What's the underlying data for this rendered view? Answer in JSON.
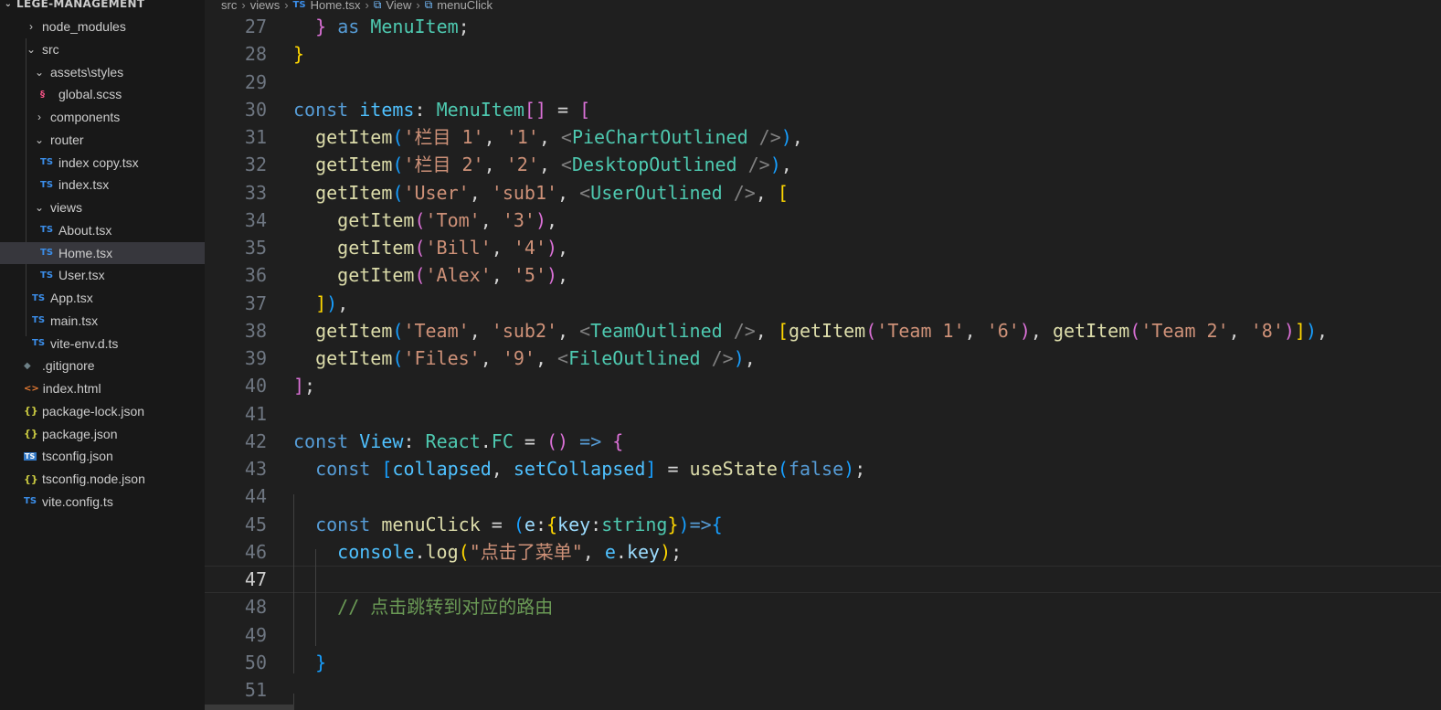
{
  "explorer": {
    "project_name": "LEGE-MANAGEMENT",
    "items": [
      {
        "label": "node_modules",
        "type": "folder",
        "expanded": false,
        "depth": 0,
        "icon": "chevron-right"
      },
      {
        "label": "src",
        "type": "folder",
        "expanded": true,
        "depth": 0,
        "icon": "chevron-down"
      },
      {
        "label": "assets\\styles",
        "type": "folder",
        "expanded": true,
        "depth": 1,
        "icon": "chevron-down"
      },
      {
        "label": "global.scss",
        "type": "file",
        "depth": 2,
        "icon": "scss-icon"
      },
      {
        "label": "components",
        "type": "folder",
        "expanded": false,
        "depth": 1,
        "icon": "chevron-right"
      },
      {
        "label": "router",
        "type": "folder",
        "expanded": true,
        "depth": 1,
        "icon": "chevron-down"
      },
      {
        "label": "index copy.tsx",
        "type": "file",
        "depth": 2,
        "icon": "ts-icon"
      },
      {
        "label": "index.tsx",
        "type": "file",
        "depth": 2,
        "icon": "ts-icon"
      },
      {
        "label": "views",
        "type": "folder",
        "expanded": true,
        "depth": 1,
        "icon": "chevron-down"
      },
      {
        "label": "About.tsx",
        "type": "file",
        "depth": 2,
        "icon": "ts-icon"
      },
      {
        "label": "Home.tsx",
        "type": "file",
        "depth": 2,
        "icon": "ts-icon",
        "selected": true
      },
      {
        "label": "User.tsx",
        "type": "file",
        "depth": 2,
        "icon": "ts-icon"
      },
      {
        "label": "App.tsx",
        "type": "file",
        "depth": 1,
        "icon": "ts-icon"
      },
      {
        "label": "main.tsx",
        "type": "file",
        "depth": 1,
        "icon": "ts-icon"
      },
      {
        "label": "vite-env.d.ts",
        "type": "file",
        "depth": 1,
        "icon": "ts-icon"
      },
      {
        "label": ".gitignore",
        "type": "file",
        "depth": 0,
        "icon": "git-icon"
      },
      {
        "label": "index.html",
        "type": "file",
        "depth": 0,
        "icon": "html-icon"
      },
      {
        "label": "package-lock.json",
        "type": "file",
        "depth": 0,
        "icon": "json-icon"
      },
      {
        "label": "package.json",
        "type": "file",
        "depth": 0,
        "icon": "json-icon"
      },
      {
        "label": "tsconfig.json",
        "type": "file",
        "depth": 0,
        "icon": "tsconfig-icon"
      },
      {
        "label": "tsconfig.node.json",
        "type": "file",
        "depth": 0,
        "icon": "json-icon"
      },
      {
        "label": "vite.config.ts",
        "type": "file",
        "depth": 0,
        "icon": "ts-icon"
      }
    ]
  },
  "breadcrumb": {
    "items": [
      "src",
      "views",
      "Home.tsx",
      "View",
      "menuClick"
    ],
    "ts_badge": "TS"
  },
  "editor": {
    "current_line": 47,
    "lines": [
      {
        "n": "27",
        "tokens": [
          [
            "  ",
            "punc"
          ],
          [
            "}",
            "b2"
          ],
          [
            " ",
            "punc"
          ],
          [
            "as",
            "kw"
          ],
          [
            " ",
            "punc"
          ],
          [
            "MenuItem",
            "type"
          ],
          [
            ";",
            "punc"
          ]
        ]
      },
      {
        "n": "28",
        "tokens": [
          [
            "}",
            "b1"
          ]
        ]
      },
      {
        "n": "29",
        "tokens": []
      },
      {
        "n": "30",
        "tokens": [
          [
            "const",
            "kw"
          ],
          [
            " ",
            "punc"
          ],
          [
            "items",
            "var"
          ],
          [
            ": ",
            "punc"
          ],
          [
            "MenuItem",
            "type"
          ],
          [
            "[]",
            "b2"
          ],
          [
            " = ",
            "punc"
          ],
          [
            "[",
            "b2"
          ]
        ]
      },
      {
        "n": "31",
        "tokens": [
          [
            "  ",
            "punc"
          ],
          [
            "getItem",
            "fn"
          ],
          [
            "(",
            "b3"
          ],
          [
            "'栏目 1'",
            "str"
          ],
          [
            ", ",
            "punc"
          ],
          [
            "'1'",
            "str"
          ],
          [
            ", ",
            "punc"
          ],
          [
            "<",
            "tag"
          ],
          [
            "PieChartOutlined",
            "type"
          ],
          [
            " />",
            "tag"
          ],
          [
            ")",
            "b3"
          ],
          [
            ",",
            "punc"
          ]
        ]
      },
      {
        "n": "32",
        "tokens": [
          [
            "  ",
            "punc"
          ],
          [
            "getItem",
            "fn"
          ],
          [
            "(",
            "b3"
          ],
          [
            "'栏目 2'",
            "str"
          ],
          [
            ", ",
            "punc"
          ],
          [
            "'2'",
            "str"
          ],
          [
            ", ",
            "punc"
          ],
          [
            "<",
            "tag"
          ],
          [
            "DesktopOutlined",
            "type"
          ],
          [
            " />",
            "tag"
          ],
          [
            ")",
            "b3"
          ],
          [
            ",",
            "punc"
          ]
        ]
      },
      {
        "n": "33",
        "tokens": [
          [
            "  ",
            "punc"
          ],
          [
            "getItem",
            "fn"
          ],
          [
            "(",
            "b3"
          ],
          [
            "'User'",
            "str"
          ],
          [
            ", ",
            "punc"
          ],
          [
            "'sub1'",
            "str"
          ],
          [
            ", ",
            "punc"
          ],
          [
            "<",
            "tag"
          ],
          [
            "UserOutlined",
            "type"
          ],
          [
            " />",
            "tag"
          ],
          [
            ", ",
            "punc"
          ],
          [
            "[",
            "b1"
          ]
        ]
      },
      {
        "n": "34",
        "tokens": [
          [
            "    ",
            "punc"
          ],
          [
            "getItem",
            "fn"
          ],
          [
            "(",
            "b2"
          ],
          [
            "'Tom'",
            "str"
          ],
          [
            ", ",
            "punc"
          ],
          [
            "'3'",
            "str"
          ],
          [
            ")",
            "b2"
          ],
          [
            ",",
            "punc"
          ]
        ]
      },
      {
        "n": "35",
        "tokens": [
          [
            "    ",
            "punc"
          ],
          [
            "getItem",
            "fn"
          ],
          [
            "(",
            "b2"
          ],
          [
            "'Bill'",
            "str"
          ],
          [
            ", ",
            "punc"
          ],
          [
            "'4'",
            "str"
          ],
          [
            ")",
            "b2"
          ],
          [
            ",",
            "punc"
          ]
        ]
      },
      {
        "n": "36",
        "tokens": [
          [
            "    ",
            "punc"
          ],
          [
            "getItem",
            "fn"
          ],
          [
            "(",
            "b2"
          ],
          [
            "'Alex'",
            "str"
          ],
          [
            ", ",
            "punc"
          ],
          [
            "'5'",
            "str"
          ],
          [
            ")",
            "b2"
          ],
          [
            ",",
            "punc"
          ]
        ]
      },
      {
        "n": "37",
        "tokens": [
          [
            "  ",
            "punc"
          ],
          [
            "]",
            "b1"
          ],
          [
            ")",
            "b3"
          ],
          [
            ",",
            "punc"
          ]
        ]
      },
      {
        "n": "38",
        "tokens": [
          [
            "  ",
            "punc"
          ],
          [
            "getItem",
            "fn"
          ],
          [
            "(",
            "b3"
          ],
          [
            "'Team'",
            "str"
          ],
          [
            ", ",
            "punc"
          ],
          [
            "'sub2'",
            "str"
          ],
          [
            ", ",
            "punc"
          ],
          [
            "<",
            "tag"
          ],
          [
            "TeamOutlined",
            "type"
          ],
          [
            " />",
            "tag"
          ],
          [
            ", ",
            "punc"
          ],
          [
            "[",
            "b1"
          ],
          [
            "getItem",
            "fn"
          ],
          [
            "(",
            "b2"
          ],
          [
            "'Team 1'",
            "str"
          ],
          [
            ", ",
            "punc"
          ],
          [
            "'6'",
            "str"
          ],
          [
            ")",
            "b2"
          ],
          [
            ", ",
            "punc"
          ],
          [
            "getItem",
            "fn"
          ],
          [
            "(",
            "b2"
          ],
          [
            "'Team 2'",
            "str"
          ],
          [
            ", ",
            "punc"
          ],
          [
            "'8'",
            "str"
          ],
          [
            ")",
            "b2"
          ],
          [
            "]",
            "b1"
          ],
          [
            ")",
            "b3"
          ],
          [
            ",",
            "punc"
          ]
        ]
      },
      {
        "n": "39",
        "tokens": [
          [
            "  ",
            "punc"
          ],
          [
            "getItem",
            "fn"
          ],
          [
            "(",
            "b3"
          ],
          [
            "'Files'",
            "str"
          ],
          [
            ", ",
            "punc"
          ],
          [
            "'9'",
            "str"
          ],
          [
            ", ",
            "punc"
          ],
          [
            "<",
            "tag"
          ],
          [
            "FileOutlined",
            "type"
          ],
          [
            " />",
            "tag"
          ],
          [
            ")",
            "b3"
          ],
          [
            ",",
            "punc"
          ]
        ]
      },
      {
        "n": "40",
        "tokens": [
          [
            "]",
            "b2"
          ],
          [
            ";",
            "punc"
          ]
        ]
      },
      {
        "n": "41",
        "tokens": []
      },
      {
        "n": "42",
        "tokens": [
          [
            "const",
            "kw"
          ],
          [
            " ",
            "punc"
          ],
          [
            "View",
            "var"
          ],
          [
            ": ",
            "punc"
          ],
          [
            "React",
            "type"
          ],
          [
            ".",
            "punc"
          ],
          [
            "FC",
            "type"
          ],
          [
            " = ",
            "punc"
          ],
          [
            "()",
            "b2"
          ],
          [
            " ",
            "punc"
          ],
          [
            "=>",
            "kw"
          ],
          [
            " ",
            "punc"
          ],
          [
            "{",
            "b2"
          ]
        ]
      },
      {
        "n": "43",
        "tokens": [
          [
            "  ",
            "punc"
          ],
          [
            "const",
            "kw"
          ],
          [
            " ",
            "punc"
          ],
          [
            "[",
            "b3"
          ],
          [
            "collapsed",
            "var"
          ],
          [
            ", ",
            "punc"
          ],
          [
            "setCollapsed",
            "var"
          ],
          [
            "]",
            "b3"
          ],
          [
            " = ",
            "punc"
          ],
          [
            "useState",
            "fn"
          ],
          [
            "(",
            "b3"
          ],
          [
            "false",
            "kw"
          ],
          [
            ")",
            "b3"
          ],
          [
            ";",
            "punc"
          ]
        ]
      },
      {
        "n": "44",
        "tokens": []
      },
      {
        "n": "45",
        "tokens": [
          [
            "  ",
            "punc"
          ],
          [
            "const",
            "kw"
          ],
          [
            " ",
            "punc"
          ],
          [
            "menuClick",
            "fn"
          ],
          [
            " = ",
            "punc"
          ],
          [
            "(",
            "b3"
          ],
          [
            "e",
            "prop"
          ],
          [
            ":",
            "punc"
          ],
          [
            "{",
            "b1"
          ],
          [
            "key",
            "prop"
          ],
          [
            ":",
            "punc"
          ],
          [
            "string",
            "type"
          ],
          [
            "}",
            "b1"
          ],
          [
            ")",
            "b3"
          ],
          [
            "=>",
            "kw"
          ],
          [
            "{",
            "b3"
          ]
        ]
      },
      {
        "n": "46",
        "tokens": [
          [
            "    ",
            "punc"
          ],
          [
            "console",
            "var"
          ],
          [
            ".",
            "punc"
          ],
          [
            "log",
            "fn"
          ],
          [
            "(",
            "b1"
          ],
          [
            "\"点击了菜单\"",
            "str"
          ],
          [
            ", ",
            "punc"
          ],
          [
            "e",
            "var"
          ],
          [
            ".",
            "punc"
          ],
          [
            "key",
            "prop"
          ],
          [
            ")",
            "b1"
          ],
          [
            ";",
            "punc"
          ]
        ]
      },
      {
        "n": "47",
        "tokens": []
      },
      {
        "n": "48",
        "tokens": [
          [
            "    ",
            "punc"
          ],
          [
            "// 点击跳转到对应的路由",
            "cmt"
          ]
        ]
      },
      {
        "n": "49",
        "tokens": []
      },
      {
        "n": "50",
        "tokens": [
          [
            "  ",
            "punc"
          ],
          [
            "}",
            "b3"
          ]
        ]
      },
      {
        "n": "51",
        "tokens": []
      }
    ]
  }
}
